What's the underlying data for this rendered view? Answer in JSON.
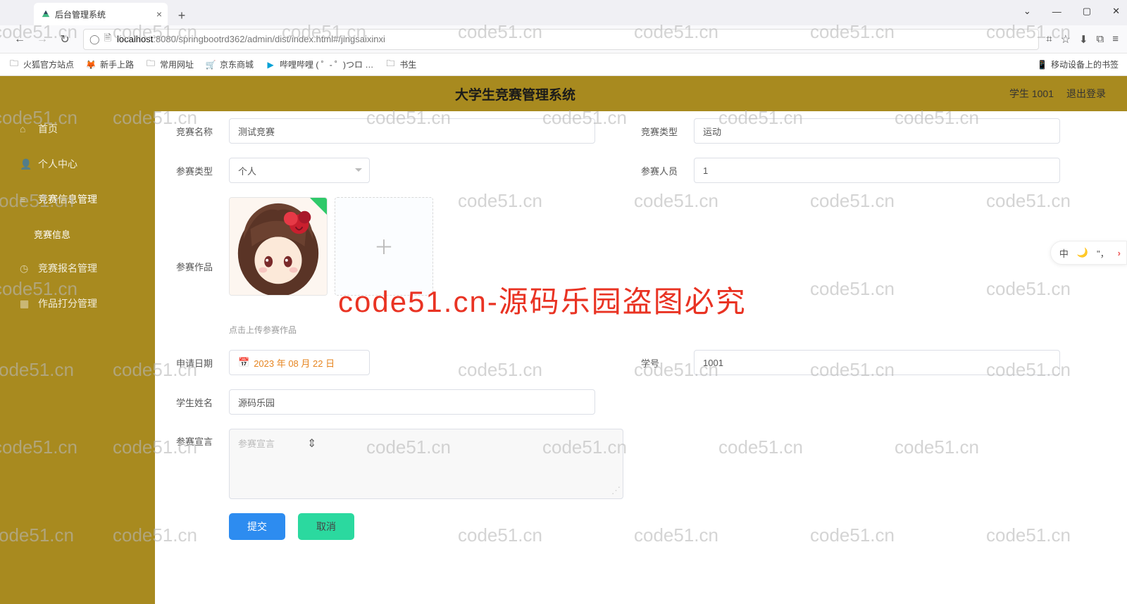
{
  "window": {
    "min": "—",
    "max": "▢",
    "close": "✕",
    "chevron": "⌄"
  },
  "tab": {
    "title": "后台管理系统",
    "add": "+"
  },
  "addr": {
    "host": "localhost",
    "port_path": ":8080/springbootrd362/admin/dist/index.html#/jingsaixinxi",
    "qr": "⌗"
  },
  "bookmarks": {
    "items": [
      "火狐官方站点",
      "新手上路",
      "常用网址",
      "京东商城",
      "哔哩哔哩 ( ゜- ゜)つロ …",
      "书生"
    ],
    "right": "移动设备上的书签"
  },
  "app": {
    "title": "大学生竞赛管理系统",
    "user_prefix": "学生",
    "user_id": "1001",
    "logout": "退出登录"
  },
  "sidebar": {
    "home": "首页",
    "personal": "个人中心",
    "comp_info_mgmt": "竞赛信息管理",
    "comp_info": "竞赛信息",
    "signup_mgmt": "竞赛报名管理",
    "score_mgmt": "作品打分管理"
  },
  "form": {
    "labels": {
      "comp_name": "竞赛名称",
      "comp_type": "竞赛类型",
      "entry_type": "参赛类型",
      "entry_people": "参赛人员",
      "entry_work": "参赛作品",
      "upload_hint": "点击上传参赛作品",
      "apply_date": "申请日期",
      "student_no": "学号",
      "student_name": "学生姓名",
      "slogan": "参赛宣言"
    },
    "values": {
      "comp_name": "测试竞赛",
      "comp_type": "运动",
      "entry_type": "个人",
      "entry_people": "1",
      "apply_date": "2023 年 08 月 22 日",
      "student_no": "1001",
      "student_name": "源码乐园",
      "slogan_ph": "参赛宣言"
    },
    "buttons": {
      "submit": "提交",
      "cancel": "取消"
    }
  },
  "ime": {
    "lang": "中",
    "moon": "🌙",
    "comma": "\"，",
    "arrow": "›"
  },
  "watermark_text": "code51.cn",
  "big_watermark": "code51.cn-源码乐园盗图必究"
}
